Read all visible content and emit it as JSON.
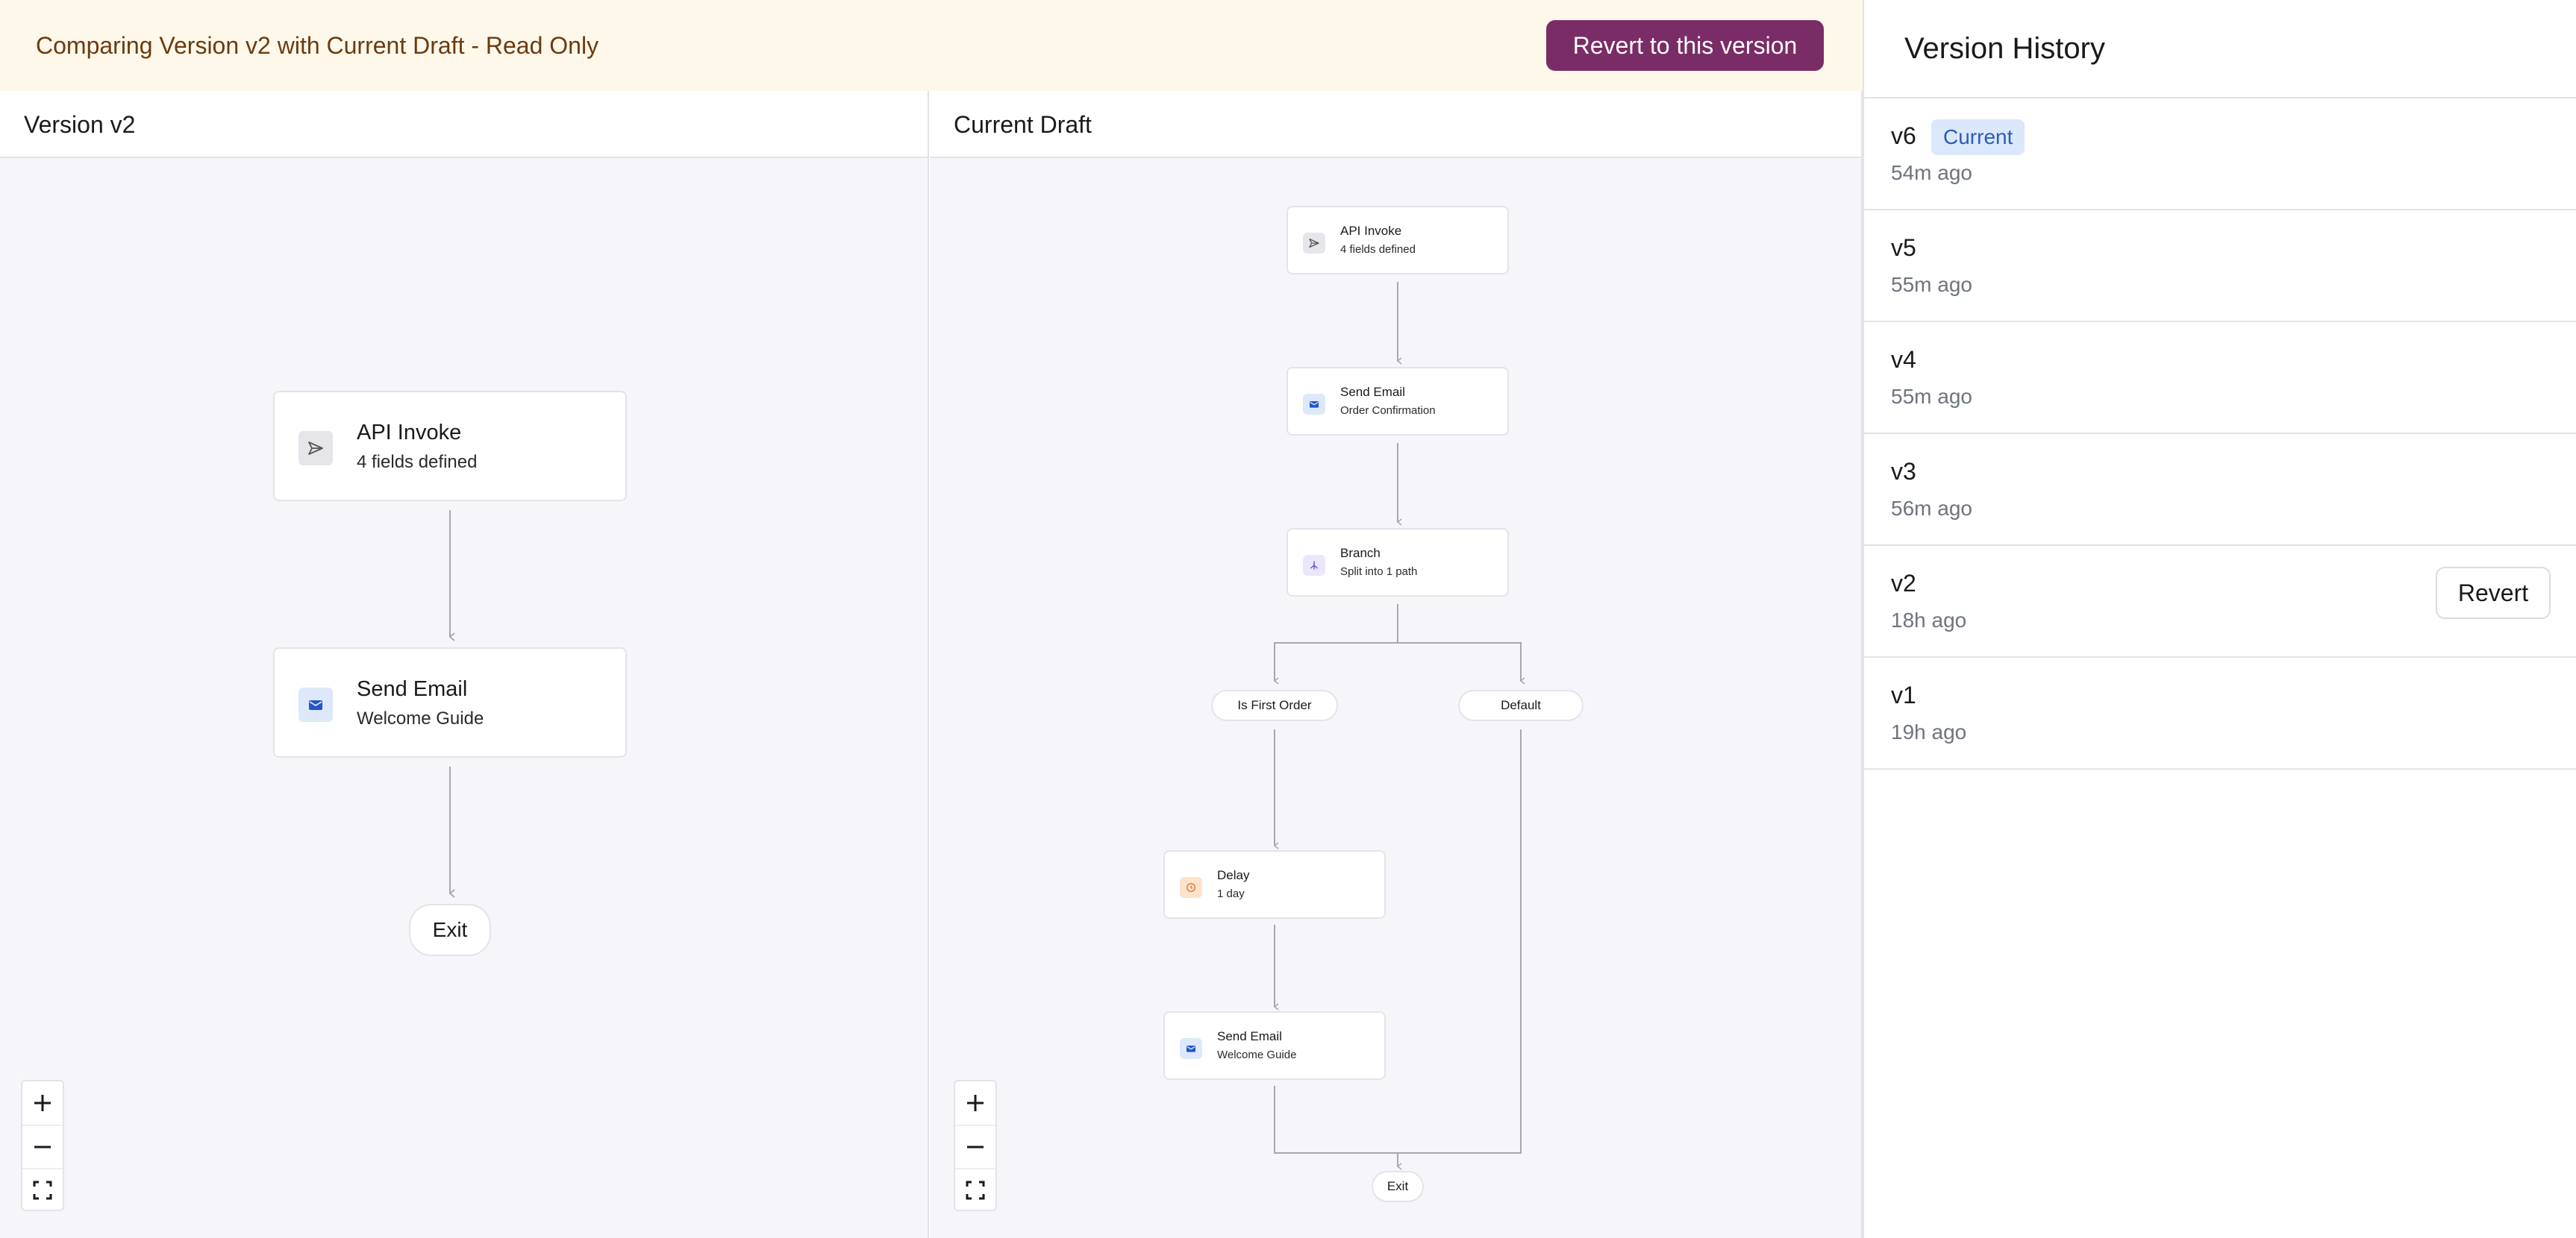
{
  "banner": {
    "text": "Comparing Version v2 with Current Draft - Read Only",
    "revert_button": "Revert to this version"
  },
  "left_panel": {
    "title": "Version v2",
    "nodes": [
      {
        "title": "API Invoke",
        "subtitle": "4 fields defined",
        "icon": "send-icon"
      },
      {
        "title": "Send Email",
        "subtitle": "Welcome Guide",
        "icon": "mail-icon"
      }
    ],
    "exit_label": "Exit"
  },
  "right_panel": {
    "title": "Current Draft",
    "nodes": [
      {
        "title": "API Invoke",
        "subtitle": "4 fields defined",
        "icon": "send-icon"
      },
      {
        "title": "Send Email",
        "subtitle": "Order Confirmation",
        "icon": "mail-icon"
      },
      {
        "title": "Branch",
        "subtitle": "Split into 1 path",
        "icon": "branch-icon"
      },
      {
        "title": "Delay",
        "subtitle": "1 day",
        "icon": "clock-icon"
      },
      {
        "title": "Send Email",
        "subtitle": "Welcome Guide",
        "icon": "mail-icon"
      }
    ],
    "branch_labels": [
      "Is First Order",
      "Default"
    ],
    "exit_label": "Exit"
  },
  "sidebar": {
    "title": "Version History",
    "current_badge": "Current",
    "revert_label": "Revert",
    "versions": [
      {
        "label": "v6",
        "time": "54m ago",
        "current": true
      },
      {
        "label": "v5",
        "time": "55m ago"
      },
      {
        "label": "v4",
        "time": "55m ago"
      },
      {
        "label": "v3",
        "time": "56m ago"
      },
      {
        "label": "v2",
        "time": "18h ago",
        "selected": true
      },
      {
        "label": "v1",
        "time": "19h ago"
      }
    ]
  },
  "colors": {
    "banner_bg": "#fdf8e9",
    "banner_text": "#6b3a10",
    "primary": "#7a2c66",
    "badge_bg": "#dbe7fa",
    "badge_text": "#2c5cb8",
    "canvas_bg": "#f5f5fa"
  }
}
